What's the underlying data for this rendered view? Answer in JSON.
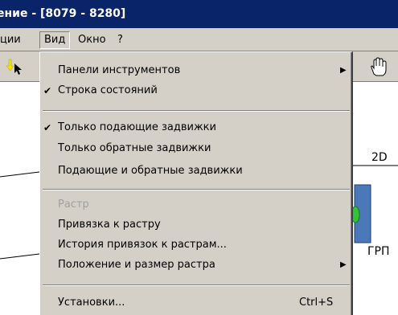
{
  "window": {
    "title": "ение - [8079 - 8280]"
  },
  "menubar": {
    "items": [
      {
        "label": "ции"
      },
      {
        "label": "Вид"
      },
      {
        "label": "Окно"
      },
      {
        "label": "?"
      }
    ]
  },
  "view_menu": {
    "groups": [
      {
        "items": [
          {
            "label": "Панели инструментов",
            "submenu": true,
            "checked": false,
            "disabled": false
          },
          {
            "label": "Строка состояний",
            "checked": true,
            "disabled": false
          }
        ]
      },
      {
        "items": [
          {
            "label": "Только подающие задвижки",
            "checked": true,
            "disabled": false
          },
          {
            "label": "Только обратные задвижки",
            "checked": false,
            "disabled": false
          },
          {
            "label": "Подающие и обратные задвижки",
            "checked": false,
            "disabled": false
          }
        ]
      },
      {
        "items": [
          {
            "label": "Растр",
            "checked": false,
            "disabled": true
          },
          {
            "label": "Привязка к растру",
            "checked": false,
            "disabled": false
          },
          {
            "label": "История привязок к растрам...",
            "checked": false,
            "disabled": false
          },
          {
            "label": "Положение и размер растра",
            "submenu": true,
            "checked": false,
            "disabled": false
          }
        ]
      },
      {
        "items": [
          {
            "label": "Установки...",
            "shortcut": "Ctrl+S",
            "checked": false,
            "disabled": false
          }
        ]
      }
    ]
  },
  "map_labels": [
    {
      "text": "2D"
    },
    {
      "text": "ГРП"
    }
  ],
  "icons": {
    "check": "checkmark-icon",
    "submenu": "submenu-arrow-icon",
    "hand": "hand-pan-icon",
    "cursor": "arrow-cursor-icon"
  },
  "colors": {
    "titlebar": "#0a246a",
    "menu_bg": "#d4d0c8",
    "disabled_text": "#a0a0a0",
    "map_node_fill": "#4a78b8",
    "map_node_accent": "#2fc43a"
  }
}
